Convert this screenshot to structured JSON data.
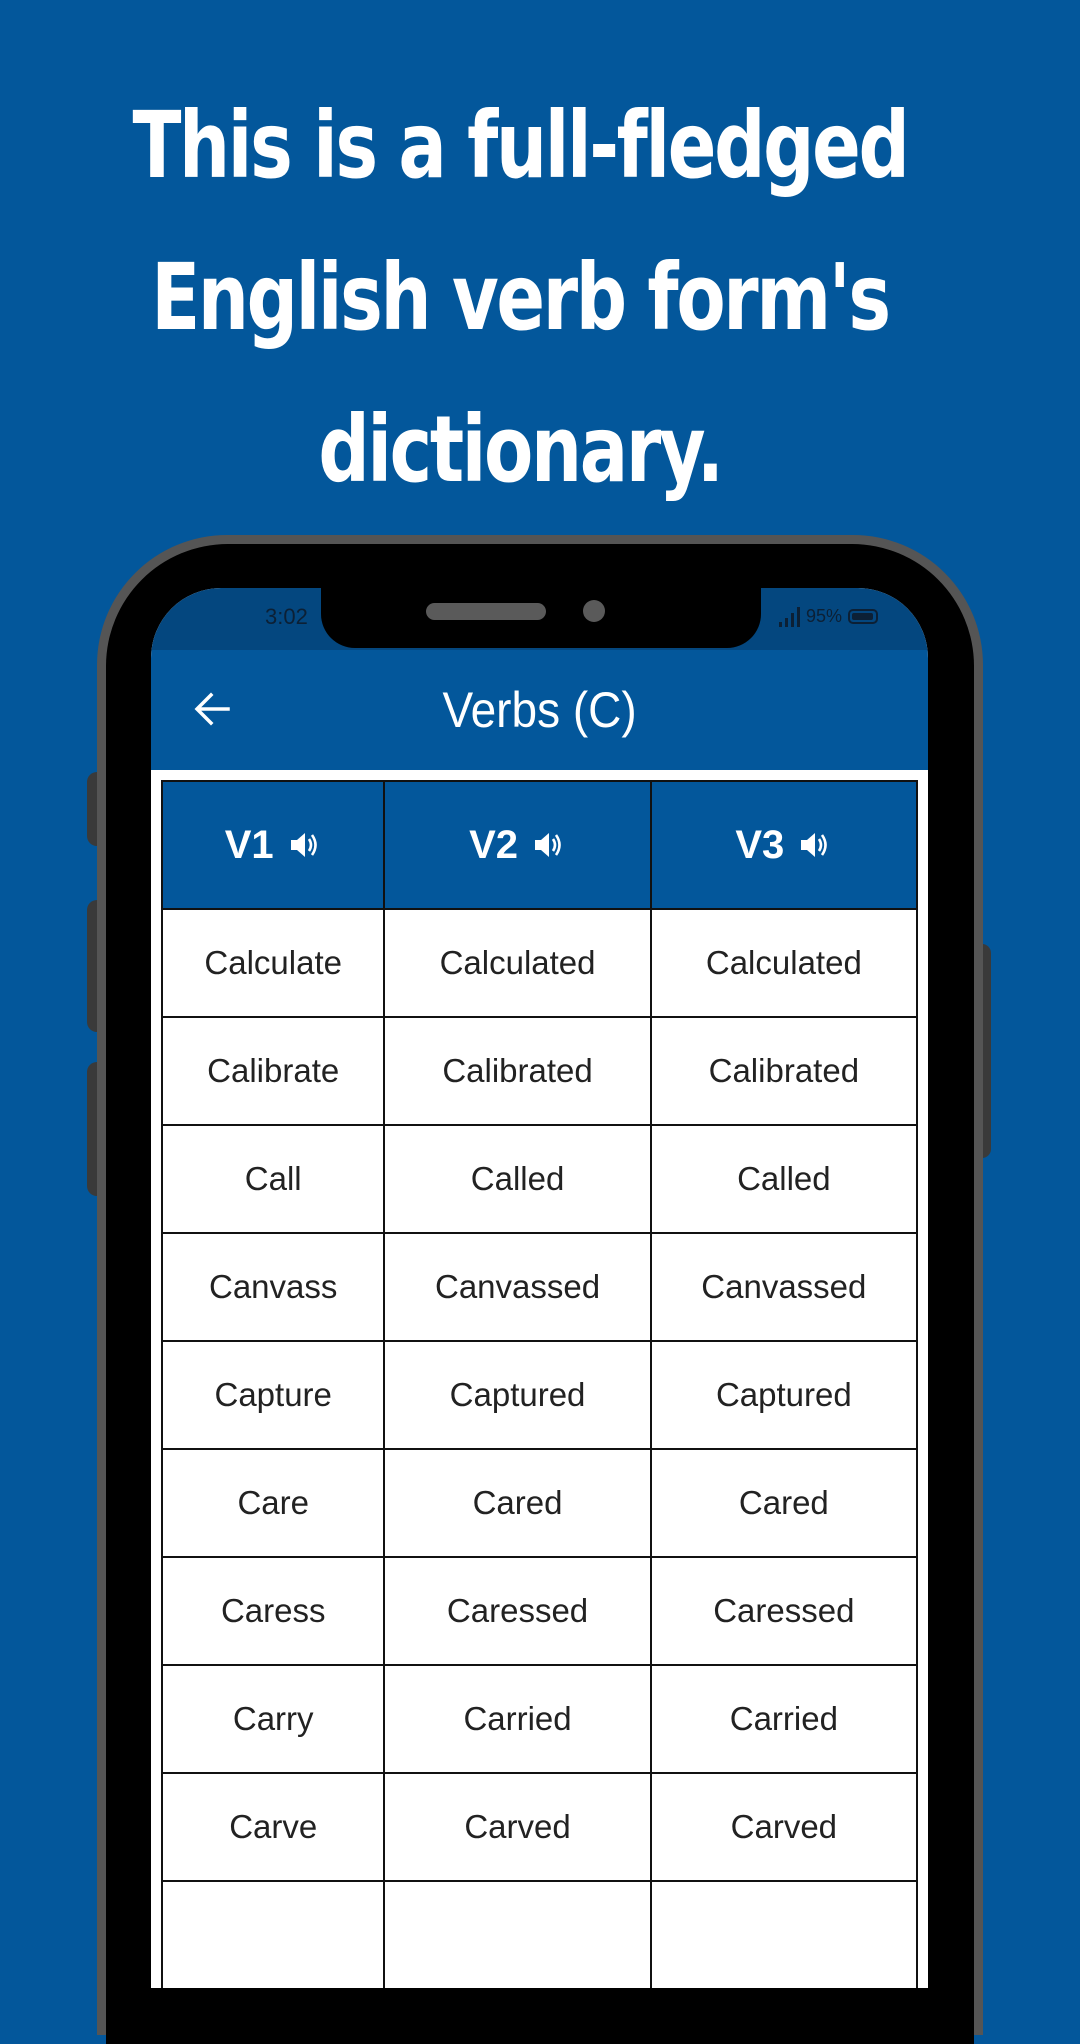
{
  "headline": {
    "lines": [
      "This is a full-fledged",
      "English verb form's",
      "dictionary."
    ]
  },
  "colors": {
    "brand_blue": "#03579b",
    "status_bar_blue": "#04477f",
    "phone_rim": "#555555",
    "table_border": "#111111"
  },
  "status_bar": {
    "time": "3:02",
    "battery": "95%",
    "signal_icon": "signal-bars-icon",
    "battery_icon": "battery-icon"
  },
  "app_bar": {
    "back_icon": "arrow-left-icon",
    "title": "Verbs (C)"
  },
  "table": {
    "columns": [
      {
        "label": "V1",
        "icon": "speaker-volume-icon"
      },
      {
        "label": "V2",
        "icon": "speaker-volume-icon"
      },
      {
        "label": "V3",
        "icon": "speaker-volume-icon"
      }
    ],
    "rows": [
      [
        "Calculate",
        "Calculated",
        "Calculated"
      ],
      [
        "Calibrate",
        "Calibrated",
        "Calibrated"
      ],
      [
        "Call",
        "Called",
        "Called"
      ],
      [
        "Canvass",
        "Canvassed",
        "Canvassed"
      ],
      [
        "Capture",
        "Captured",
        "Captured"
      ],
      [
        "Care",
        "Cared",
        "Cared"
      ],
      [
        "Caress",
        "Caressed",
        "Caressed"
      ],
      [
        "Carry",
        "Carried",
        "Carried"
      ],
      [
        "Carve",
        "Carved",
        "Carved"
      ],
      [
        "",
        "",
        ""
      ]
    ]
  }
}
